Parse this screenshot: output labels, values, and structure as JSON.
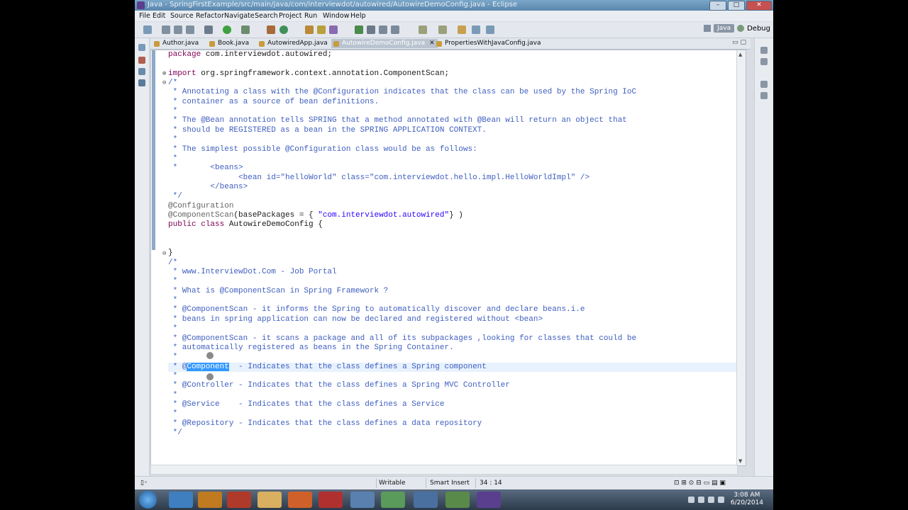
{
  "window": {
    "title": "Java - SpringFirstExample/src/main/java/com/interviewdot/autowired/AutowireDemoConfig.java - Eclipse",
    "controls": [
      "–",
      "□",
      "✕"
    ]
  },
  "menu": [
    "File",
    "Edit",
    "Source",
    "Refactor",
    "Navigate",
    "Search",
    "Project",
    "Run",
    "Window",
    "Help"
  ],
  "perspective": {
    "java": "Java",
    "debug": "Debug"
  },
  "tabs": [
    {
      "label": "Author.java",
      "active": false
    },
    {
      "label": "Book.java",
      "active": false
    },
    {
      "label": "AutowiredApp.java",
      "active": false
    },
    {
      "label": "AutowireDemoConfig.java",
      "active": true
    },
    {
      "label": "PropertiesWithJavaConfig.java",
      "active": false
    }
  ],
  "tabs_overflow": "",
  "code_lines": [
    "package com.interviewdot.autowired;",
    "",
    "import org.springframework.context.annotation.ComponentScan;",
    "/*",
    " * Annotating a class with the @Configuration indicates that the class can be used by the Spring IoC",
    " * container as a source of bean definitions.",
    " *",
    " * The @Bean annotation tells SPRING that a method annotated with @Bean will return an object that",
    " * should be REGISTERED as a bean in the SPRING APPLICATION CONTEXT.",
    " *",
    " * The simplest possible @Configuration class would be as follows:",
    " *",
    " *       <beans>",
    "               <bean id=\"helloWorld\" class=\"com.interviewdot.hello.impl.HelloWorldImpl\" />",
    "         </beans>",
    " */",
    "@Configuration",
    "@ComponentScan(basePackages = { \"com.interviewdot.autowired\"} )",
    "public class AutowireDemoConfig {",
    "",
    "",
    "}",
    "/*",
    " * www.InterviewDot.Com - Job Portal",
    " *",
    " * What is @ComponentScan in Spring Framework ?",
    " *",
    " * @ComponentScan - it informs the Spring to automatically discover and declare beans.i.e",
    " * beans in spring application can now be declared and registered without <bean>",
    " *",
    " * @ComponentScan - it scans a package and all of its subpackages ,looking for classes that could be",
    " * automatically registered as beans in the Spring Container.",
    " *",
    " * @Component  - Indicates that the class defines a Spring component",
    " *",
    " * @Controller - Indicates that the class defines a Spring MVC Controller",
    " *",
    " * @Service    - Indicates that the class defines a Service",
    " *",
    " * @Repository - Indicates that the class defines a data repository",
    " */"
  ],
  "selected_text": "Component",
  "status": {
    "writable": "Writable",
    "insert_mode": "Smart Insert",
    "position": "34 : 14"
  },
  "clock": {
    "time": "3:08 AM",
    "date": "6/20/2014"
  },
  "colors": {
    "comment": "#3f5fbf",
    "keyword": "#7f0055",
    "annotation": "#646464",
    "string": "#2a00ff",
    "selection": "#3399ff"
  }
}
